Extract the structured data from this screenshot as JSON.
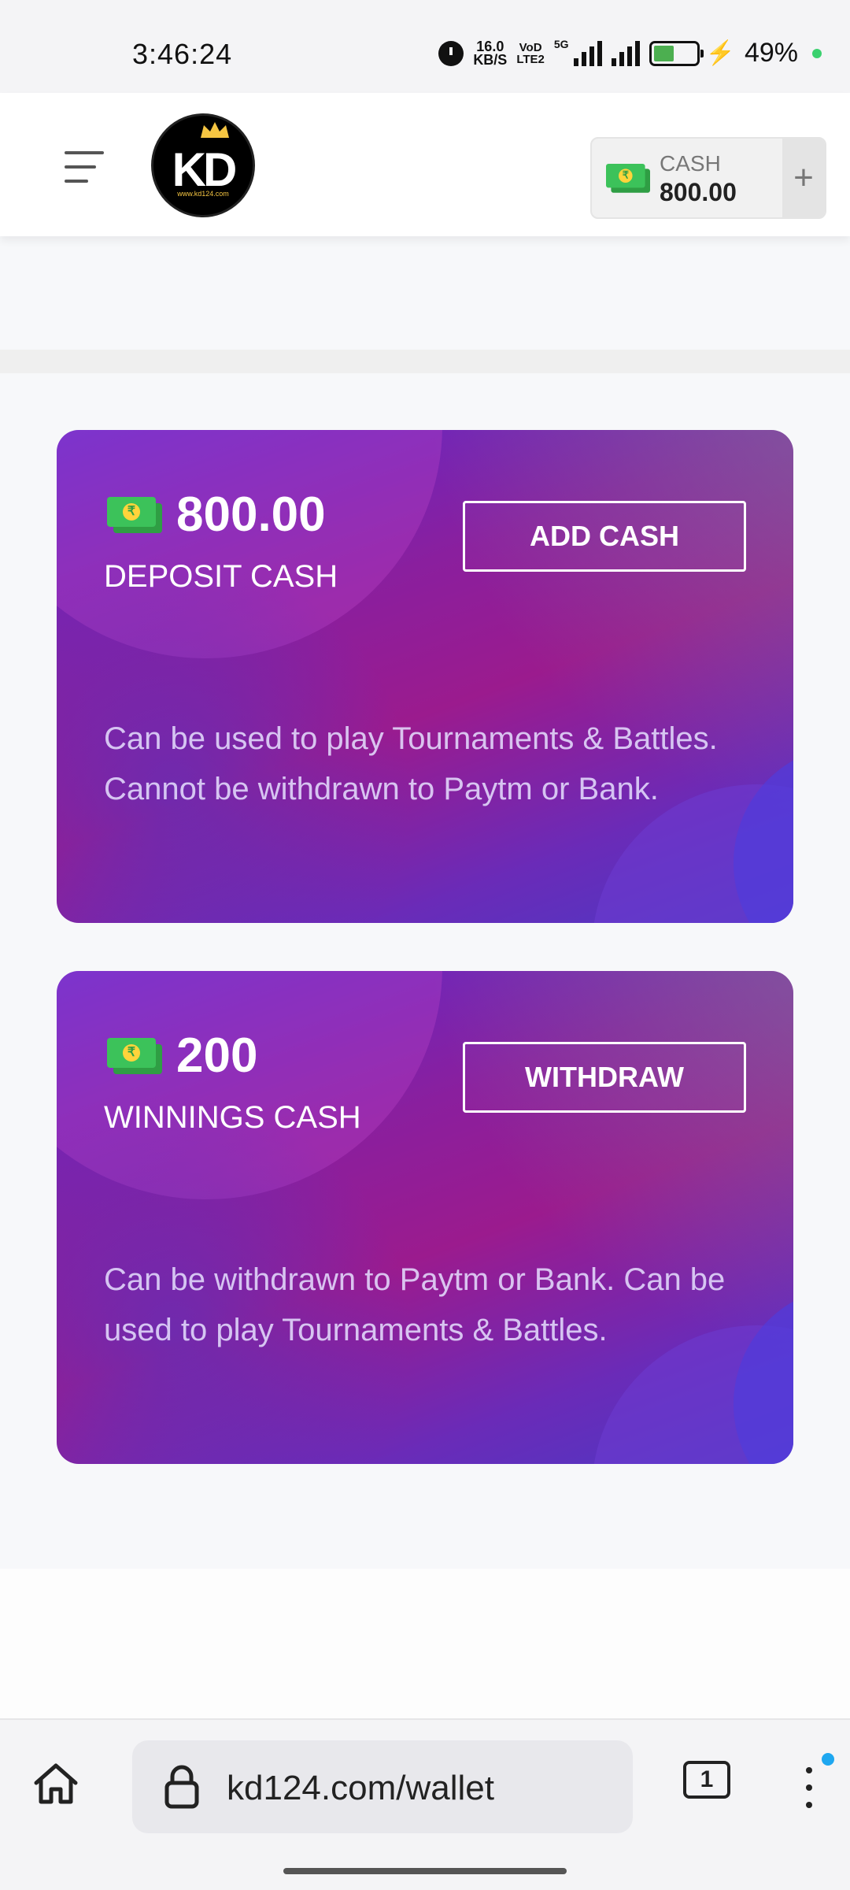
{
  "status": {
    "time": "3:46:24",
    "netspeed_value": "16.0",
    "netspeed_unit": "KB/S",
    "volte_top": "VoD",
    "volte_bottom": "LTE2",
    "network_type": "5G",
    "battery": "49%",
    "battery_level": 0.49
  },
  "header": {
    "logo_text": "KD",
    "logo_url": "www.kd124.com",
    "cash_label": "CASH",
    "cash_value": "800.00",
    "plus": "+"
  },
  "cards": [
    {
      "amount": "800.00",
      "title": "DEPOSIT CASH",
      "button": "ADD CASH",
      "desc_line1": "Can be used to play Tournaments & Battles.",
      "desc_line2": "Cannot be withdrawn to Paytm or Bank."
    },
    {
      "amount": "200",
      "title": "WINNINGS CASH",
      "button": "WITHDRAW",
      "desc_line1": "Can be withdrawn to Paytm or Bank. Can be used to play Tournaments & Battles.",
      "desc_line2": ""
    }
  ],
  "browser": {
    "url": "kd124.com/wallet",
    "tab_count": "1"
  },
  "colors": {
    "card_gradient_start": "#5a2bcf",
    "card_gradient_mid": "#9b1b8e",
    "money_green": "#3cc25a",
    "accent_blue": "#1ea7f0"
  },
  "icons": [
    "alarm-icon",
    "signal-icon",
    "battery-icon",
    "hamburger-icon",
    "money-icon",
    "home-icon",
    "lock-icon",
    "tabs-icon",
    "more-icon"
  ]
}
